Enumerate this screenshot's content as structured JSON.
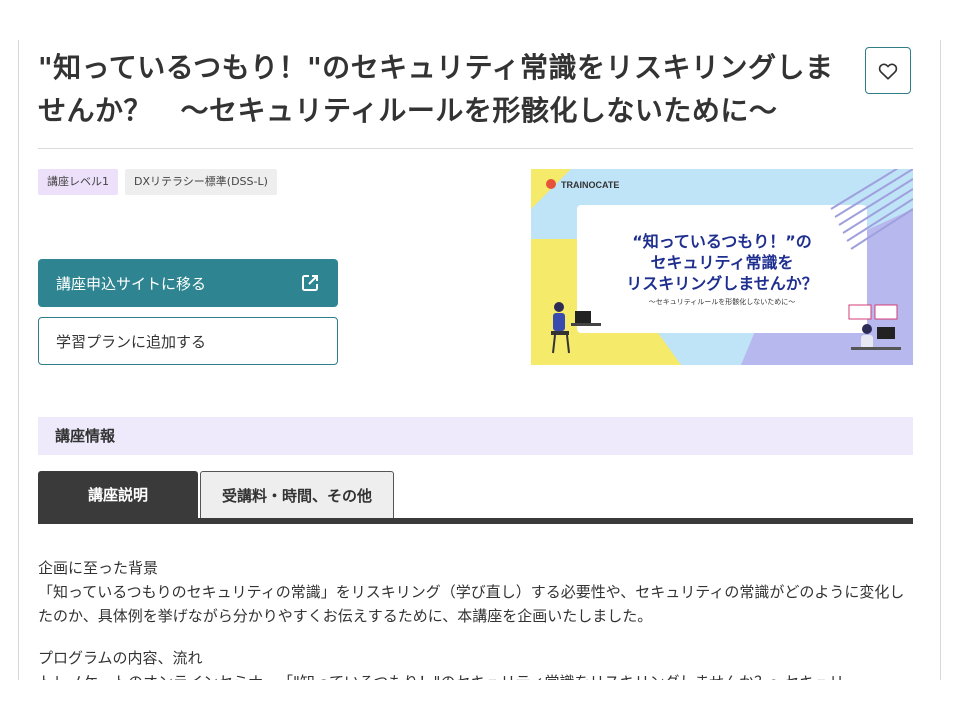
{
  "course": {
    "title": "\"知っているつもり！\"のセキュリティ常識をリスキリングしませんか？　～セキュリティルールを形骸化しないために～"
  },
  "tags": [
    {
      "label": "講座レベル1"
    },
    {
      "label": "DXリテラシー標準(DSS-L)"
    }
  ],
  "actions": {
    "apply_label": "講座申込サイトに移る",
    "plan_label": "学習プランに追加する"
  },
  "banner": {
    "brand": "TRAINOCATE",
    "line1": "“知っているつもり！”の",
    "line2": "セキュリティ常識を",
    "line3": "リスキリングしませんか？",
    "subtitle": "～セキュリティルールを形骸化しないために～"
  },
  "section": {
    "info_heading": "講座情報"
  },
  "tabs": [
    {
      "label": "講座説明",
      "active": true
    },
    {
      "label": "受講料・時間、その他",
      "active": false
    }
  ],
  "description": {
    "heading1": "企画に至った背景",
    "body1": "「知っているつもりのセキュリティの常識」をリスキリング（学び直し）する必要性や、セキュリティの常識がどのように変化したのか、具体例を挙げながら分かりやすくお伝えするために、本講座を企画いたしました。",
    "heading2": "プログラムの内容、流れ",
    "body2": "トレノケートのオンラインセミナー「\"知っているつもり！\"のセキュリティ常識をリスキリングしませんか？～セキュリ"
  },
  "colors": {
    "primary": "#2e8591",
    "tab_dark": "#3a3a3a",
    "section_bg": "#eeeafb",
    "tag_level_bg": "#ece0fa"
  },
  "icons": {
    "favorite": "heart-outline-icon",
    "external": "external-link-icon"
  }
}
